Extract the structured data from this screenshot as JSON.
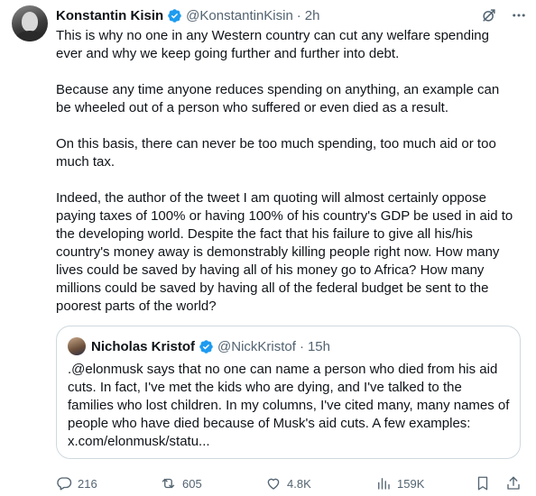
{
  "tweet": {
    "author_name": "Konstantin Kisin",
    "author_handle": "@KonstantinKisin",
    "separator": "·",
    "time": "2h",
    "paragraphs": [
      "This is why no one in any Western country can cut any welfare spending ever and why we keep going further and further into debt.",
      "Because any time anyone reduces spending on anything, an example can be wheeled out of a person who suffered or even died as a result.",
      "On this basis, there can never be too much spending, too much aid or too much tax.",
      "Indeed, the author of the tweet I am quoting will almost certainly oppose paying taxes of 100% or having 100% of his country's GDP be used in aid to the developing world. Despite the fact that his failure to give all his/his country's money away is demonstrably killing people right now. How many lives could be saved by having all of his money go to Africa? How many millions could be saved by having all of the federal budget be sent to the poorest parts of the world?"
    ]
  },
  "quote": {
    "author_name": "Nicholas Kristof",
    "author_handle": "@NickKristof",
    "separator": "·",
    "time": "15h",
    "text": ".@elonmusk says that no one can name a person who died from his aid cuts. In fact, I've met the kids who are dying, and I've talked to the families who lost children. In my columns, I've cited many, many names of people who have died because of Musk's  aid cuts. A few examples: x.com/elonmusk/statu..."
  },
  "actions": {
    "replies": "216",
    "reposts": "605",
    "likes": "4.8K",
    "views": "159K"
  },
  "colors": {
    "verified": "#1d9bf0",
    "muted": "#536471",
    "border": "#cfd9de"
  },
  "icons": [
    "grok-icon",
    "more-icon",
    "verified-badge-icon",
    "reply-icon",
    "repost-icon",
    "like-icon",
    "views-icon",
    "bookmark-icon",
    "share-icon"
  ]
}
